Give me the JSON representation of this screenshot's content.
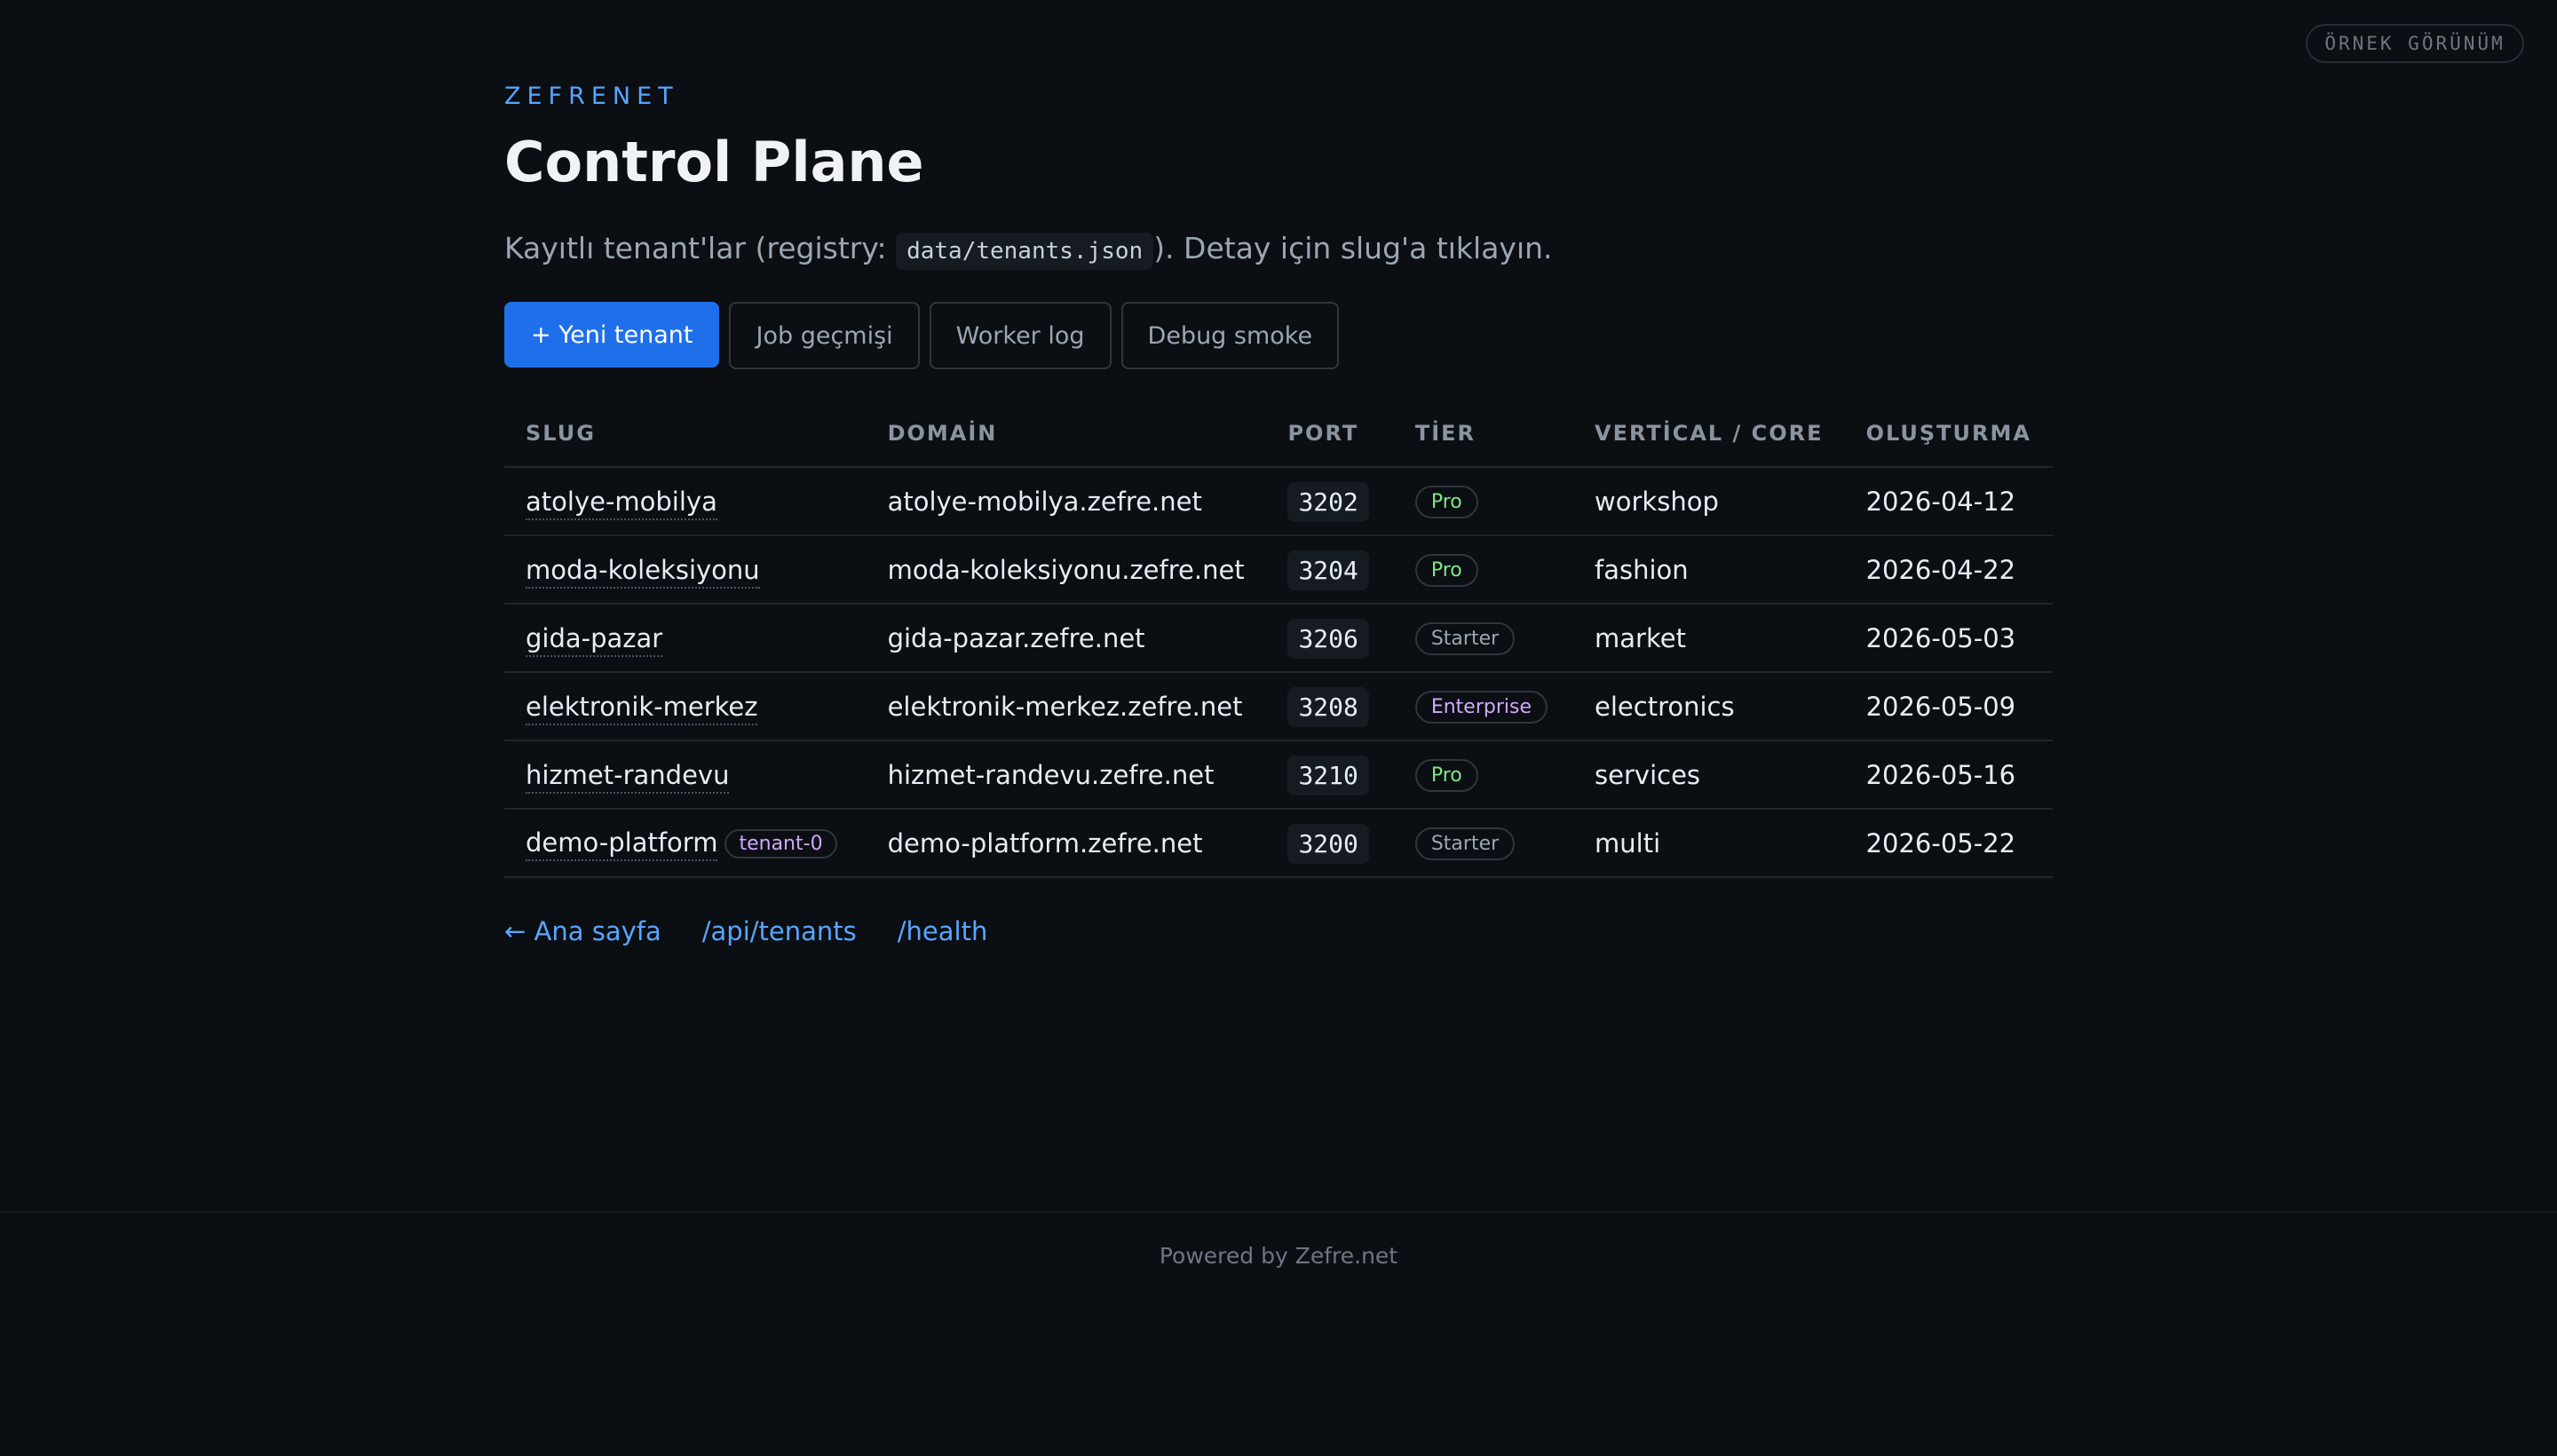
{
  "badge": "ÖRNEK GÖRÜNÜM",
  "header": {
    "brand": "ZEFRENET",
    "title": "Control Plane",
    "subtitle_prefix": "Kayıtlı tenant'lar (registry: ",
    "subtitle_code": "data/tenants.json",
    "subtitle_suffix": "). Detay için slug'a tıklayın."
  },
  "toolbar": {
    "new_tenant": "+ Yeni tenant",
    "job_history": "Job geçmişi",
    "worker_log": "Worker log",
    "debug_smoke": "Debug smoke"
  },
  "table": {
    "headers": [
      "SLUG",
      "DOMAİN",
      "PORT",
      "TİER",
      "VERTİCAL / CORE",
      "OLUŞTURMA"
    ],
    "rows": [
      {
        "slug": "atolye-mobilya",
        "domain": "atolye-mobilya.zefre.net",
        "port": "3202",
        "tier": "Pro",
        "vertical": "workshop",
        "created": "2026-04-12"
      },
      {
        "slug": "moda-koleksiyonu",
        "domain": "moda-koleksiyonu.zefre.net",
        "port": "3204",
        "tier": "Pro",
        "vertical": "fashion",
        "created": "2026-04-22"
      },
      {
        "slug": "gida-pazar",
        "domain": "gida-pazar.zefre.net",
        "port": "3206",
        "tier": "Starter",
        "vertical": "market",
        "created": "2026-05-03"
      },
      {
        "slug": "elektronik-merkez",
        "domain": "elektronik-merkez.zefre.net",
        "port": "3208",
        "tier": "Enterprise",
        "vertical": "electronics",
        "created": "2026-05-09"
      },
      {
        "slug": "hizmet-randevu",
        "domain": "hizmet-randevu.zefre.net",
        "port": "3210",
        "tier": "Pro",
        "vertical": "services",
        "created": "2026-05-16"
      },
      {
        "slug": "demo-platform",
        "slug_tag": "tenant-0",
        "domain": "demo-platform.zefre.net",
        "port": "3200",
        "tier": "Starter",
        "vertical": "multi",
        "created": "2026-05-22"
      }
    ]
  },
  "links": {
    "home": "← Ana sayfa",
    "api_tenants": "/api/tenants",
    "health": "/health"
  },
  "footer": "Powered by Zefre.net",
  "colors": {
    "background": "#0b0e13",
    "accent": "#58a6ff",
    "primary_button": "#1f6feb",
    "tier_pro": "#7ee787",
    "tier_enterprise": "#d2a8ff"
  }
}
